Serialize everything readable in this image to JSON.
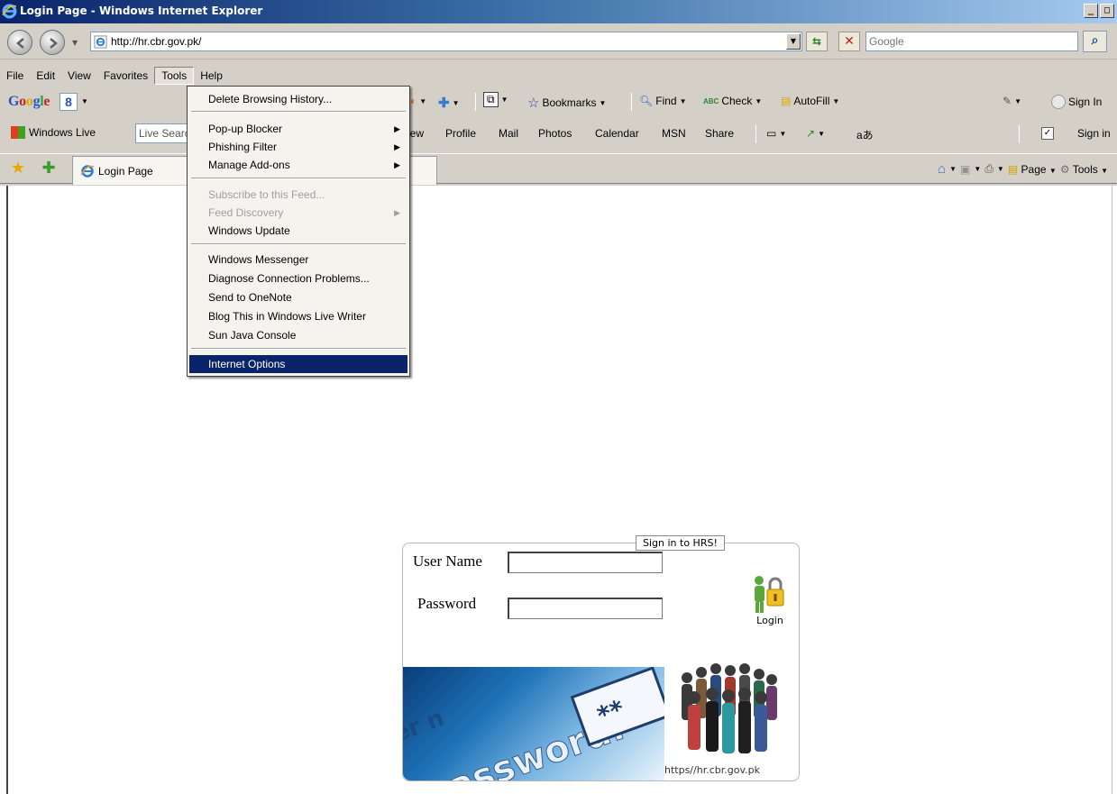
{
  "window": {
    "title": "Login Page - Windows Internet Explorer",
    "minimize_label": "_",
    "maximize_label": "□"
  },
  "address": {
    "url": "http://hr.cbr.gov.pk/",
    "search_placeholder": "Google"
  },
  "menubar": {
    "items": [
      "File",
      "Edit",
      "View",
      "Favorites",
      "Tools",
      "Help"
    ]
  },
  "google_toolbar": {
    "logo": "Google",
    "bookmarks": "Bookmarks",
    "find": "Find",
    "check": "Check",
    "autofill": "AutoFill",
    "sign_in": "Sign In",
    "spell_icon_text": "ABC"
  },
  "live_toolbar": {
    "logo_label": "Windows Live",
    "search_text": "Live Search",
    "links": [
      "iew",
      "Profile",
      "Mail",
      "Photos",
      "Calendar",
      "MSN",
      "Share"
    ],
    "translate_icon_text": "aあ",
    "sign_in": "Sign in"
  },
  "tabbar": {
    "tab_title": "Login Page",
    "page_label": "Page",
    "tools_label": "Tools"
  },
  "tools_menu": {
    "items": [
      {
        "label": "Delete Browsing History...",
        "disabled": false,
        "submenu": false
      },
      {
        "label": "Pop-up Blocker",
        "disabled": false,
        "submenu": true
      },
      {
        "label": "Phishing Filter",
        "disabled": false,
        "submenu": true
      },
      {
        "label": "Manage Add-ons",
        "disabled": false,
        "submenu": true
      },
      {
        "label": "Subscribe to this Feed...",
        "disabled": true,
        "submenu": false
      },
      {
        "label": "Feed Discovery",
        "disabled": true,
        "submenu": true
      },
      {
        "label": "Windows Update",
        "disabled": false,
        "submenu": false
      },
      {
        "label": "Windows Messenger",
        "disabled": false,
        "submenu": false
      },
      {
        "label": "Diagnose Connection Problems...",
        "disabled": false,
        "submenu": false
      },
      {
        "label": "Send to OneNote",
        "disabled": false,
        "submenu": false
      },
      {
        "label": "Blog This in Windows Live Writer",
        "disabled": false,
        "submenu": false
      },
      {
        "label": "Sun Java Console",
        "disabled": false,
        "submenu": false
      },
      {
        "label": "Internet Options",
        "disabled": false,
        "submenu": false,
        "selected": true
      }
    ]
  },
  "login": {
    "legend": "Sign in to HRS!",
    "username_label": "User Name",
    "username_value": "",
    "password_label": "Password",
    "password_value": "",
    "button_label": "Login",
    "banner_word": "password:",
    "banner_masked": "**",
    "banner_partial": "er n",
    "site_url": "https//hr.cbr.gov.pk"
  }
}
